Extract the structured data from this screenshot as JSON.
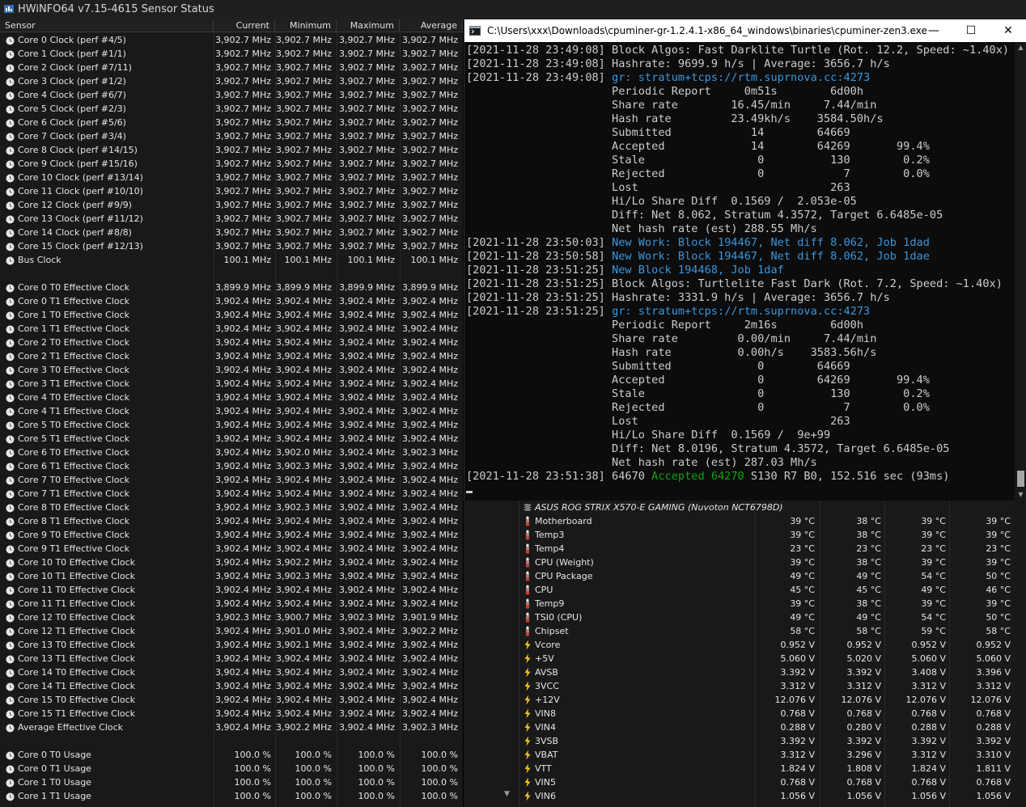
{
  "app": {
    "title": "HWiNFO64 v7.15-4615 Sensor Status"
  },
  "columns": {
    "sensor": "Sensor",
    "current": "Current",
    "minimum": "Minimum",
    "maximum": "Maximum",
    "average": "Average"
  },
  "left_rows": [
    {
      "name": "Core 0 Clock (perf #4/5)",
      "cur": "3,902.7 MHz",
      "min": "3,902.7 MHz",
      "max": "3,902.7 MHz",
      "avg": "3,902.7 MHz"
    },
    {
      "name": "Core 1 Clock (perf #1/1)",
      "cur": "3,902.7 MHz",
      "min": "3,902.7 MHz",
      "max": "3,902.7 MHz",
      "avg": "3,902.7 MHz"
    },
    {
      "name": "Core 2 Clock (perf #7/11)",
      "cur": "3,902.7 MHz",
      "min": "3,902.7 MHz",
      "max": "3,902.7 MHz",
      "avg": "3,902.7 MHz"
    },
    {
      "name": "Core 3 Clock (perf #1/2)",
      "cur": "3,902.7 MHz",
      "min": "3,902.7 MHz",
      "max": "3,902.7 MHz",
      "avg": "3,902.7 MHz"
    },
    {
      "name": "Core 4 Clock (perf #6/7)",
      "cur": "3,902.7 MHz",
      "min": "3,902.7 MHz",
      "max": "3,902.7 MHz",
      "avg": "3,902.7 MHz"
    },
    {
      "name": "Core 5 Clock (perf #2/3)",
      "cur": "3,902.7 MHz",
      "min": "3,902.7 MHz",
      "max": "3,902.7 MHz",
      "avg": "3,902.7 MHz"
    },
    {
      "name": "Core 6 Clock (perf #5/6)",
      "cur": "3,902.7 MHz",
      "min": "3,902.7 MHz",
      "max": "3,902.7 MHz",
      "avg": "3,902.7 MHz"
    },
    {
      "name": "Core 7 Clock (perf #3/4)",
      "cur": "3,902.7 MHz",
      "min": "3,902.7 MHz",
      "max": "3,902.7 MHz",
      "avg": "3,902.7 MHz"
    },
    {
      "name": "Core 8 Clock (perf #14/15)",
      "cur": "3,902.7 MHz",
      "min": "3,902.7 MHz",
      "max": "3,902.7 MHz",
      "avg": "3,902.7 MHz"
    },
    {
      "name": "Core 9 Clock (perf #15/16)",
      "cur": "3,902.7 MHz",
      "min": "3,902.7 MHz",
      "max": "3,902.7 MHz",
      "avg": "3,902.7 MHz"
    },
    {
      "name": "Core 10 Clock (perf #13/14)",
      "cur": "3,902.7 MHz",
      "min": "3,902.7 MHz",
      "max": "3,902.7 MHz",
      "avg": "3,902.7 MHz"
    },
    {
      "name": "Core 11 Clock (perf #10/10)",
      "cur": "3,902.7 MHz",
      "min": "3,902.7 MHz",
      "max": "3,902.7 MHz",
      "avg": "3,902.7 MHz"
    },
    {
      "name": "Core 12 Clock (perf #9/9)",
      "cur": "3,902.7 MHz",
      "min": "3,902.7 MHz",
      "max": "3,902.7 MHz",
      "avg": "3,902.7 MHz"
    },
    {
      "name": "Core 13 Clock (perf #11/12)",
      "cur": "3,902.7 MHz",
      "min": "3,902.7 MHz",
      "max": "3,902.7 MHz",
      "avg": "3,902.7 MHz"
    },
    {
      "name": "Core 14 Clock (perf #8/8)",
      "cur": "3,902.7 MHz",
      "min": "3,902.7 MHz",
      "max": "3,902.7 MHz",
      "avg": "3,902.7 MHz"
    },
    {
      "name": "Core 15 Clock (perf #12/13)",
      "cur": "3,902.7 MHz",
      "min": "3,902.7 MHz",
      "max": "3,902.7 MHz",
      "avg": "3,902.7 MHz"
    },
    {
      "name": "Bus Clock",
      "cur": "100.1 MHz",
      "min": "100.1 MHz",
      "max": "100.1 MHz",
      "avg": "100.1 MHz"
    },
    {
      "blank": true
    },
    {
      "name": "Core 0 T0 Effective Clock",
      "cur": "3,899.9 MHz",
      "min": "3,899.9 MHz",
      "max": "3,899.9 MHz",
      "avg": "3,899.9 MHz"
    },
    {
      "name": "Core 0 T1 Effective Clock",
      "cur": "3,902.4 MHz",
      "min": "3,902.4 MHz",
      "max": "3,902.4 MHz",
      "avg": "3,902.4 MHz"
    },
    {
      "name": "Core 1 T0 Effective Clock",
      "cur": "3,902.4 MHz",
      "min": "3,902.4 MHz",
      "max": "3,902.4 MHz",
      "avg": "3,902.4 MHz"
    },
    {
      "name": "Core 1 T1 Effective Clock",
      "cur": "3,902.4 MHz",
      "min": "3,902.4 MHz",
      "max": "3,902.4 MHz",
      "avg": "3,902.4 MHz"
    },
    {
      "name": "Core 2 T0 Effective Clock",
      "cur": "3,902.4 MHz",
      "min": "3,902.4 MHz",
      "max": "3,902.4 MHz",
      "avg": "3,902.4 MHz"
    },
    {
      "name": "Core 2 T1 Effective Clock",
      "cur": "3,902.4 MHz",
      "min": "3,902.4 MHz",
      "max": "3,902.4 MHz",
      "avg": "3,902.4 MHz"
    },
    {
      "name": "Core 3 T0 Effective Clock",
      "cur": "3,902.4 MHz",
      "min": "3,902.4 MHz",
      "max": "3,902.4 MHz",
      "avg": "3,902.4 MHz"
    },
    {
      "name": "Core 3 T1 Effective Clock",
      "cur": "3,902.4 MHz",
      "min": "3,902.4 MHz",
      "max": "3,902.4 MHz",
      "avg": "3,902.4 MHz"
    },
    {
      "name": "Core 4 T0 Effective Clock",
      "cur": "3,902.4 MHz",
      "min": "3,902.4 MHz",
      "max": "3,902.4 MHz",
      "avg": "3,902.4 MHz"
    },
    {
      "name": "Core 4 T1 Effective Clock",
      "cur": "3,902.4 MHz",
      "min": "3,902.4 MHz",
      "max": "3,902.4 MHz",
      "avg": "3,902.4 MHz"
    },
    {
      "name": "Core 5 T0 Effective Clock",
      "cur": "3,902.4 MHz",
      "min": "3,902.4 MHz",
      "max": "3,902.4 MHz",
      "avg": "3,902.4 MHz"
    },
    {
      "name": "Core 5 T1 Effective Clock",
      "cur": "3,902.4 MHz",
      "min": "3,902.4 MHz",
      "max": "3,902.4 MHz",
      "avg": "3,902.4 MHz"
    },
    {
      "name": "Core 6 T0 Effective Clock",
      "cur": "3,902.4 MHz",
      "min": "3,902.0 MHz",
      "max": "3,902.4 MHz",
      "avg": "3,902.3 MHz"
    },
    {
      "name": "Core 6 T1 Effective Clock",
      "cur": "3,902.4 MHz",
      "min": "3,902.3 MHz",
      "max": "3,902.4 MHz",
      "avg": "3,902.4 MHz"
    },
    {
      "name": "Core 7 T0 Effective Clock",
      "cur": "3,902.4 MHz",
      "min": "3,902.4 MHz",
      "max": "3,902.4 MHz",
      "avg": "3,902.4 MHz"
    },
    {
      "name": "Core 7 T1 Effective Clock",
      "cur": "3,902.4 MHz",
      "min": "3,902.4 MHz",
      "max": "3,902.4 MHz",
      "avg": "3,902.4 MHz"
    },
    {
      "name": "Core 8 T0 Effective Clock",
      "cur": "3,902.4 MHz",
      "min": "3,902.3 MHz",
      "max": "3,902.4 MHz",
      "avg": "3,902.4 MHz"
    },
    {
      "name": "Core 8 T1 Effective Clock",
      "cur": "3,902.4 MHz",
      "min": "3,902.4 MHz",
      "max": "3,902.4 MHz",
      "avg": "3,902.4 MHz"
    },
    {
      "name": "Core 9 T0 Effective Clock",
      "cur": "3,902.4 MHz",
      "min": "3,902.4 MHz",
      "max": "3,902.4 MHz",
      "avg": "3,902.4 MHz"
    },
    {
      "name": "Core 9 T1 Effective Clock",
      "cur": "3,902.4 MHz",
      "min": "3,902.4 MHz",
      "max": "3,902.4 MHz",
      "avg": "3,902.4 MHz"
    },
    {
      "name": "Core 10 T0 Effective Clock",
      "cur": "3,902.4 MHz",
      "min": "3,902.2 MHz",
      "max": "3,902.4 MHz",
      "avg": "3,902.4 MHz"
    },
    {
      "name": "Core 10 T1 Effective Clock",
      "cur": "3,902.4 MHz",
      "min": "3,902.3 MHz",
      "max": "3,902.4 MHz",
      "avg": "3,902.4 MHz"
    },
    {
      "name": "Core 11 T0 Effective Clock",
      "cur": "3,902.4 MHz",
      "min": "3,902.4 MHz",
      "max": "3,902.4 MHz",
      "avg": "3,902.4 MHz"
    },
    {
      "name": "Core 11 T1 Effective Clock",
      "cur": "3,902.4 MHz",
      "min": "3,902.4 MHz",
      "max": "3,902.4 MHz",
      "avg": "3,902.4 MHz"
    },
    {
      "name": "Core 12 T0 Effective Clock",
      "cur": "3,902.3 MHz",
      "min": "3,900.7 MHz",
      "max": "3,902.3 MHz",
      "avg": "3,901.9 MHz"
    },
    {
      "name": "Core 12 T1 Effective Clock",
      "cur": "3,902.4 MHz",
      "min": "3,901.0 MHz",
      "max": "3,902.4 MHz",
      "avg": "3,902.2 MHz"
    },
    {
      "name": "Core 13 T0 Effective Clock",
      "cur": "3,902.4 MHz",
      "min": "3,902.1 MHz",
      "max": "3,902.4 MHz",
      "avg": "3,902.4 MHz"
    },
    {
      "name": "Core 13 T1 Effective Clock",
      "cur": "3,902.4 MHz",
      "min": "3,902.4 MHz",
      "max": "3,902.4 MHz",
      "avg": "3,902.4 MHz"
    },
    {
      "name": "Core 14 T0 Effective Clock",
      "cur": "3,902.4 MHz",
      "min": "3,902.4 MHz",
      "max": "3,902.4 MHz",
      "avg": "3,902.4 MHz"
    },
    {
      "name": "Core 14 T1 Effective Clock",
      "cur": "3,902.4 MHz",
      "min": "3,902.4 MHz",
      "max": "3,902.4 MHz",
      "avg": "3,902.4 MHz"
    },
    {
      "name": "Core 15 T0 Effective Clock",
      "cur": "3,902.4 MHz",
      "min": "3,902.4 MHz",
      "max": "3,902.4 MHz",
      "avg": "3,902.4 MHz"
    },
    {
      "name": "Core 15 T1 Effective Clock",
      "cur": "3,902.4 MHz",
      "min": "3,902.4 MHz",
      "max": "3,902.4 MHz",
      "avg": "3,902.4 MHz"
    },
    {
      "name": "Average Effective Clock",
      "cur": "3,902.4 MHz",
      "min": "3,902.2 MHz",
      "max": "3,902.4 MHz",
      "avg": "3,902.3 MHz"
    },
    {
      "blank": true
    },
    {
      "name": "Core 0 T0 Usage",
      "cur": "100.0 %",
      "min": "100.0 %",
      "max": "100.0 %",
      "avg": "100.0 %"
    },
    {
      "name": "Core 0 T1 Usage",
      "cur": "100.0 %",
      "min": "100.0 %",
      "max": "100.0 %",
      "avg": "100.0 %"
    },
    {
      "name": "Core 1 T0 Usage",
      "cur": "100.0 %",
      "min": "100.0 %",
      "max": "100.0 %",
      "avg": "100.0 %"
    },
    {
      "name": "Core 1 T1 Usage",
      "cur": "100.0 %",
      "min": "100.0 %",
      "max": "100.0 %",
      "avg": "100.0 %"
    }
  ],
  "console": {
    "title": "C:\\Users\\xxx\\Downloads\\cpuminer-gr-1.2.4.1-x86_64_windows\\binaries\\cpuminer-zen3.exe",
    "lines": [
      [
        {
          "t": "[2021-11-28 23:49:08] Block Algos: Fast Darklite Turtle (Rot. 12.2, Speed: ~1.40x)"
        }
      ],
      [
        {
          "t": "[2021-11-28 23:49:08] Hashrate: 9699.9 h/s | Average: 3656.7 h/s"
        }
      ],
      [
        {
          "t": "[2021-11-28 23:49:08] "
        },
        {
          "t": "gr: stratum+tcps://rtm.suprnova.cc:4273",
          "c": "blue"
        }
      ],
      [
        {
          "t": "                      Periodic Report     0m51s        6d00h"
        }
      ],
      [
        {
          "t": "                      Share rate        16.45/min     7.44/min"
        }
      ],
      [
        {
          "t": "                      Hash rate         23.49kh/s    3584.50h/s"
        }
      ],
      [
        {
          "t": "                      Submitted            14        64669"
        }
      ],
      [
        {
          "t": "                      Accepted             14        64269       99.4%"
        }
      ],
      [
        {
          "t": "                      Stale                 0          130        0.2%"
        }
      ],
      [
        {
          "t": "                      Rejected              0            7        0.0%"
        }
      ],
      [
        {
          "t": "                      Lost                             263"
        }
      ],
      [
        {
          "t": "                      Hi/Lo Share Diff  0.1569 /  2.053e-05"
        }
      ],
      [
        {
          "t": "                      Diff: Net 8.062, Stratum 4.3572, Target 6.6485e-05"
        }
      ],
      [
        {
          "t": "                      Net hash rate (est) 288.55 Mh/s"
        }
      ],
      [
        {
          "t": "[2021-11-28 23:50:03] "
        },
        {
          "t": "New Work: Block 194467, Net diff 8.062, Job 1dad",
          "c": "blue"
        }
      ],
      [
        {
          "t": "[2021-11-28 23:50:58] "
        },
        {
          "t": "New Work: Block 194467, Net diff 8.062, Job 1dae",
          "c": "blue"
        }
      ],
      [
        {
          "t": "[2021-11-28 23:51:25] "
        },
        {
          "t": "New Block 194468, Job 1daf",
          "c": "blue"
        }
      ],
      [
        {
          "t": "[2021-11-28 23:51:25] Block Algos: Turtlelite Fast Dark (Rot. 7.2, Speed: ~1.40x)"
        }
      ],
      [
        {
          "t": "[2021-11-28 23:51:25] Hashrate: 3331.9 h/s | Average: 3656.7 h/s"
        }
      ],
      [
        {
          "t": "[2021-11-28 23:51:25] "
        },
        {
          "t": "gr: stratum+tcps://rtm.suprnova.cc:4273",
          "c": "blue"
        }
      ],
      [
        {
          "t": "                      Periodic Report     2m16s        6d00h"
        }
      ],
      [
        {
          "t": "                      Share rate         0.00/min     7.44/min"
        }
      ],
      [
        {
          "t": "                      Hash rate          0.00h/s    3583.56h/s"
        }
      ],
      [
        {
          "t": "                      Submitted             0        64669"
        }
      ],
      [
        {
          "t": "                      Accepted              0        64269       99.4%"
        }
      ],
      [
        {
          "t": "                      Stale                 0          130        0.2%"
        }
      ],
      [
        {
          "t": "                      Rejected              0            7        0.0%"
        }
      ],
      [
        {
          "t": "                      Lost                             263"
        }
      ],
      [
        {
          "t": "                      Hi/Lo Share Diff  0.1569 /  9e+99"
        }
      ],
      [
        {
          "t": "                      Diff: Net 8.0196, Stratum 4.3572, Target 6.6485e-05"
        }
      ],
      [
        {
          "t": "                      Net hash rate (est) 287.03 Mh/s"
        }
      ],
      [
        {
          "t": "[2021-11-28 23:51:38] 64670 "
        },
        {
          "t": "Accepted 64270",
          "c": "green"
        },
        {
          "t": " S130 R7 B0, 152.516 sec (93ms)"
        }
      ]
    ]
  },
  "right_rows": [
    {
      "group": true,
      "name": "ASUS ROG STRIX X570-E GAMING (Nuvoton NCT6798D)"
    },
    {
      "type": "temp",
      "name": "Motherboard",
      "cur": "39 °C",
      "min": "38 °C",
      "max": "39 °C",
      "avg": "39 °C"
    },
    {
      "type": "temp",
      "name": "Temp3",
      "cur": "39 °C",
      "min": "38 °C",
      "max": "39 °C",
      "avg": "39 °C"
    },
    {
      "type": "temp",
      "name": "Temp4",
      "cur": "23 °C",
      "min": "23 °C",
      "max": "23 °C",
      "avg": "23 °C"
    },
    {
      "type": "temp",
      "name": "CPU (Weight)",
      "cur": "39 °C",
      "min": "38 °C",
      "max": "39 °C",
      "avg": "39 °C"
    },
    {
      "type": "temp",
      "name": "CPU Package",
      "cur": "49 °C",
      "min": "49 °C",
      "max": "54 °C",
      "avg": "50 °C"
    },
    {
      "type": "temp",
      "name": "CPU",
      "cur": "45 °C",
      "min": "45 °C",
      "max": "49 °C",
      "avg": "46 °C"
    },
    {
      "type": "temp",
      "name": "Temp9",
      "cur": "39 °C",
      "min": "38 °C",
      "max": "39 °C",
      "avg": "39 °C"
    },
    {
      "type": "temp",
      "name": "TSI0 (CPU)",
      "cur": "49 °C",
      "min": "49 °C",
      "max": "54 °C",
      "avg": "50 °C"
    },
    {
      "type": "temp",
      "name": "Chipset",
      "cur": "58 °C",
      "min": "58 °C",
      "max": "59 °C",
      "avg": "58 °C"
    },
    {
      "type": "volt",
      "name": "Vcore",
      "cur": "0.952 V",
      "min": "0.952 V",
      "max": "0.952 V",
      "avg": "0.952 V"
    },
    {
      "type": "volt",
      "name": "+5V",
      "cur": "5.060 V",
      "min": "5.020 V",
      "max": "5.060 V",
      "avg": "5.060 V"
    },
    {
      "type": "volt",
      "name": "AVSB",
      "cur": "3.392 V",
      "min": "3.392 V",
      "max": "3.408 V",
      "avg": "3.396 V"
    },
    {
      "type": "volt",
      "name": "3VCC",
      "cur": "3.312 V",
      "min": "3.312 V",
      "max": "3.312 V",
      "avg": "3.312 V"
    },
    {
      "type": "volt",
      "name": "+12V",
      "cur": "12.076 V",
      "min": "12.076 V",
      "max": "12.076 V",
      "avg": "12.076 V"
    },
    {
      "type": "volt",
      "name": "VIN8",
      "cur": "0.768 V",
      "min": "0.768 V",
      "max": "0.768 V",
      "avg": "0.768 V"
    },
    {
      "type": "volt",
      "name": "VIN4",
      "cur": "0.288 V",
      "min": "0.280 V",
      "max": "0.288 V",
      "avg": "0.288 V"
    },
    {
      "type": "volt",
      "name": "3VSB",
      "cur": "3.392 V",
      "min": "3.392 V",
      "max": "3.392 V",
      "avg": "3.392 V"
    },
    {
      "type": "volt",
      "name": "VBAT",
      "cur": "3.312 V",
      "min": "3.296 V",
      "max": "3.312 V",
      "avg": "3.310 V"
    },
    {
      "type": "volt",
      "name": "VTT",
      "cur": "1.824 V",
      "min": "1.808 V",
      "max": "1.824 V",
      "avg": "1.811 V"
    },
    {
      "type": "volt",
      "name": "VIN5",
      "cur": "0.768 V",
      "min": "0.768 V",
      "max": "0.768 V",
      "avg": "0.768 V"
    },
    {
      "type": "volt",
      "name": "VIN6",
      "cur": "1.056 V",
      "min": "1.056 V",
      "max": "1.056 V",
      "avg": "1.056 V"
    }
  ],
  "icons": {
    "app": "hwinfo-icon",
    "clock": "clock-icon",
    "temp": "thermometer-icon",
    "volt": "lightning-icon",
    "chip": "chip-icon"
  },
  "colors": {
    "blue_text": "#3a96dd",
    "green_text": "#13a10e",
    "volt_icon": "#f5c518"
  }
}
